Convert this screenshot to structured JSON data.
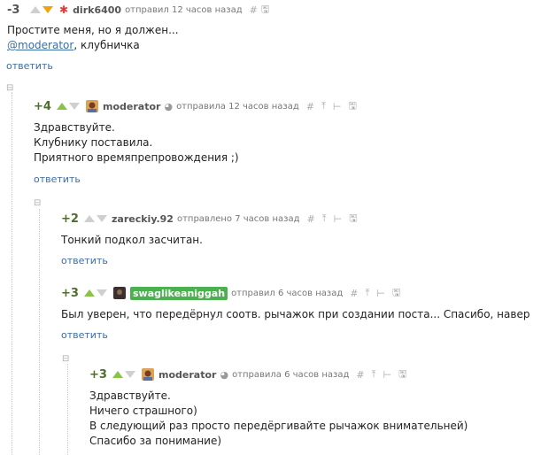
{
  "comments": [
    {
      "rating": "-3",
      "author": "dirk6400",
      "meta": "отправил 12 часов назад",
      "lines": [
        "Простите меня, но я должен..."
      ],
      "mention": "@moderator",
      "mention_tail": ", клубничка",
      "reply": "ответить"
    },
    {
      "rating": "+4",
      "author": "moderator",
      "meta": "отправила 12 часов назад",
      "lines": [
        "Здравствуйте.",
        "Клубнику поставила.",
        "Приятного времяпрепровождения ;)"
      ],
      "reply": "ответить"
    },
    {
      "rating": "+2",
      "author": "zareckiy.92",
      "meta": "отправлено 7 часов назад",
      "lines": [
        "Тонкий подкол засчитан."
      ],
      "reply": "ответить"
    },
    {
      "rating": "+3",
      "author": "swaglikeaniggah",
      "meta": "отправил 6 часов назад",
      "lines": [
        "Был уверен, что передёрнул соотв. рычажок при создании поста... Спасибо, наверное"
      ],
      "reply": "ответить"
    },
    {
      "rating": "+3",
      "author": "moderator",
      "meta": "отправила 6 часов назад",
      "lines": [
        "Здравствуйте.",
        "Ничего страшного)",
        "В следующий раз просто передёргивайте рычажок внимательней)",
        "Спасибо за понимание)"
      ]
    }
  ],
  "toolbar": {
    "hash": "#",
    "up": "⤒",
    "branch": "⊢",
    "save": "🖫"
  },
  "collapse_icon": "⊟",
  "colors": {
    "link": "#3a6ea5",
    "upvote": "#8bc34a",
    "downvote": "#f0a30a",
    "badge": "#4caf50"
  }
}
